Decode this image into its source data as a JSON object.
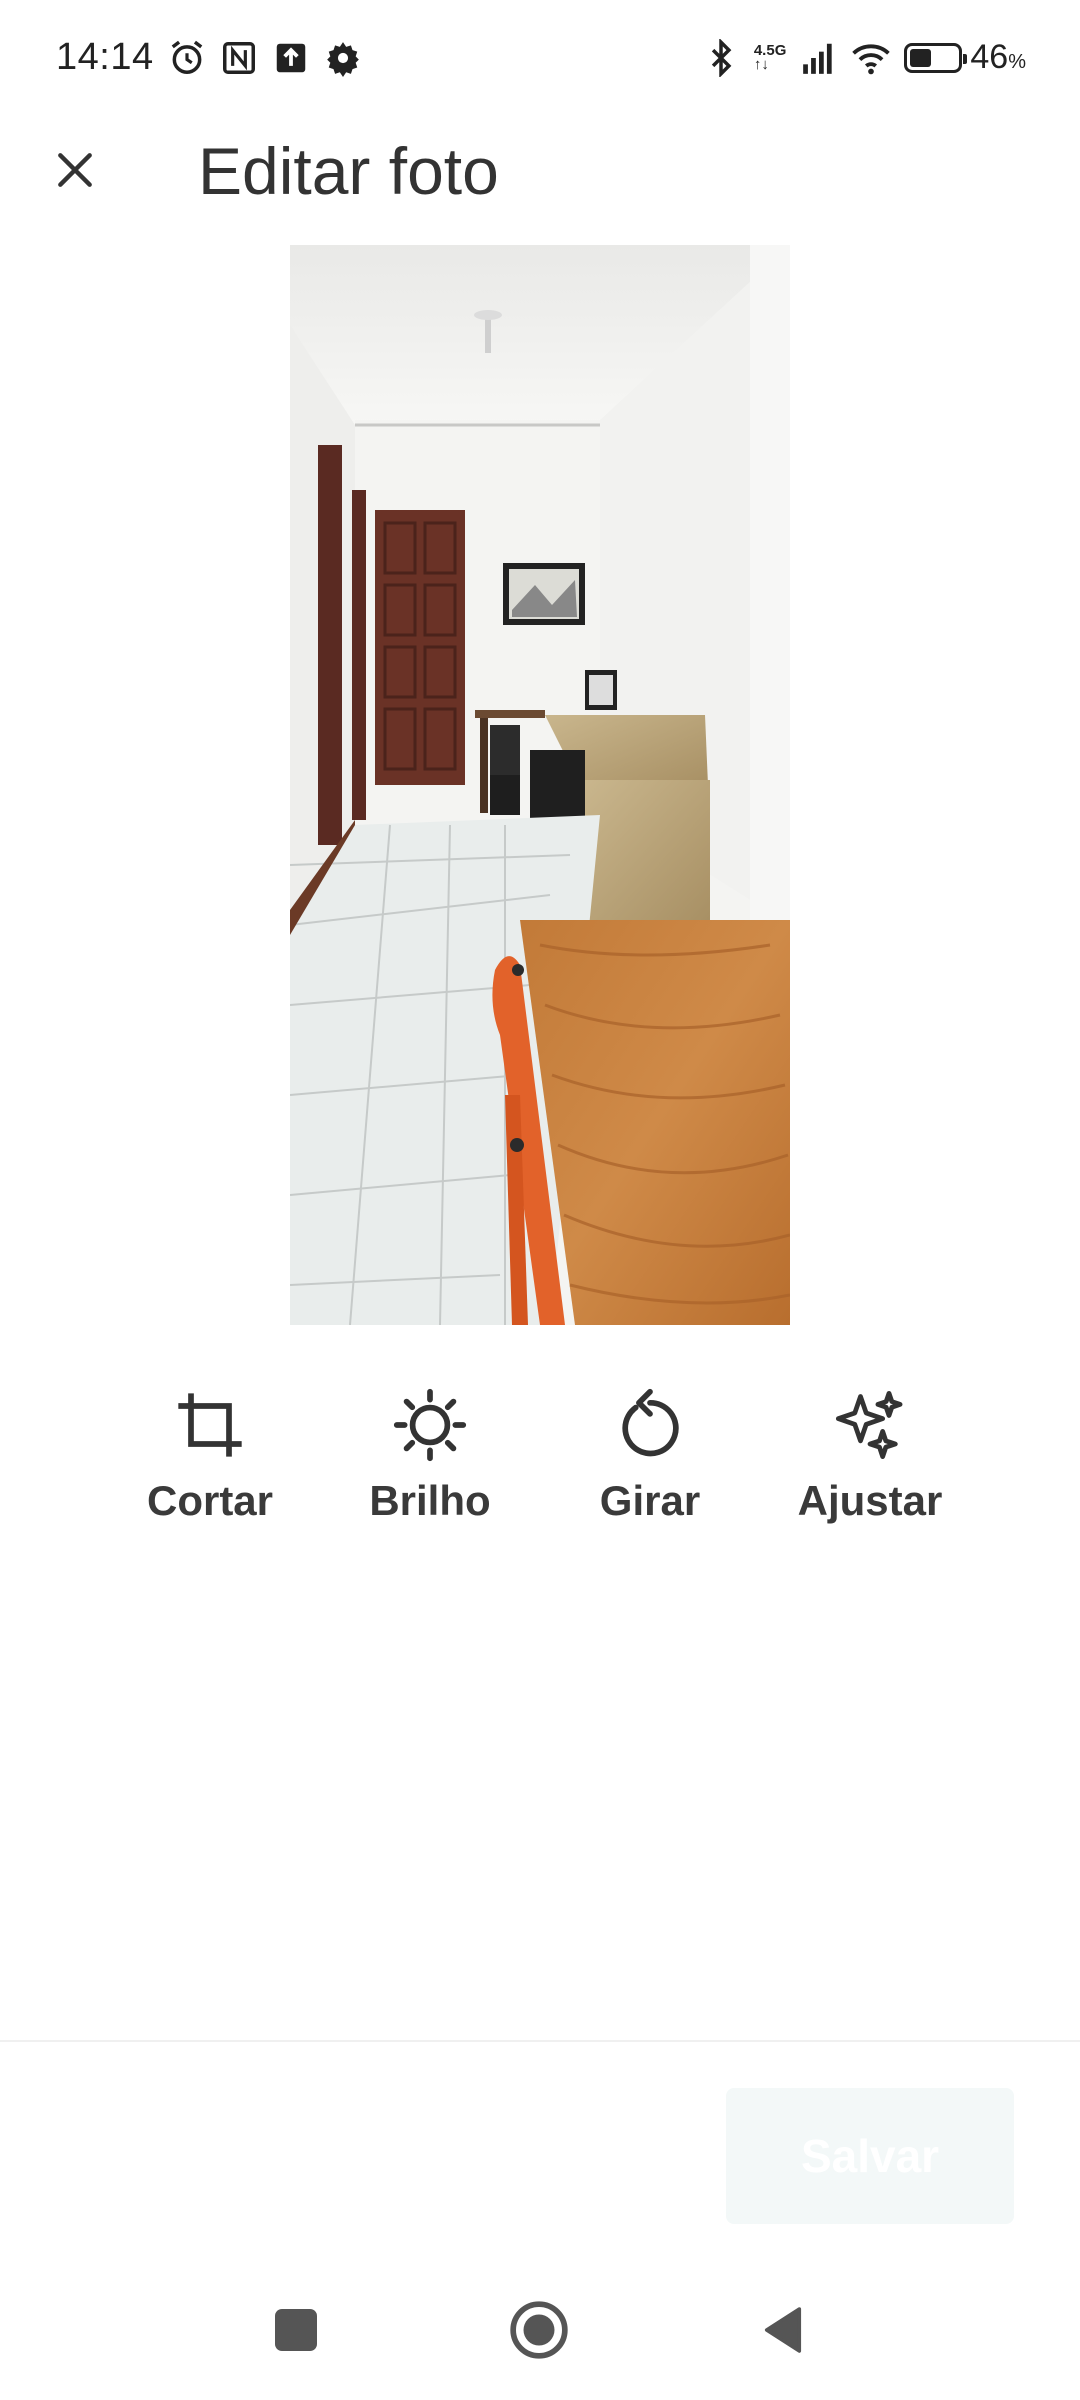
{
  "status_bar": {
    "time": "14:14",
    "network_top": "4.5G",
    "network_bottom": "↑↓",
    "battery_percent": "46",
    "battery_symbol": "%",
    "battery_level": 0.46,
    "icons": [
      "alarm-icon",
      "nfc-icon",
      "upload-icon",
      "settings-icon",
      "bluetooth-icon",
      "signal-icon",
      "wifi-icon",
      "battery-icon"
    ]
  },
  "app_bar": {
    "title": "Editar foto",
    "close_icon": "close-icon"
  },
  "photo": {
    "content": "hallway with wooden table and orange chair"
  },
  "tools": [
    {
      "label": "Cortar",
      "icon": "crop-icon"
    },
    {
      "label": "Brilho",
      "icon": "brightness-icon"
    },
    {
      "label": "Girar",
      "icon": "rotate-icon"
    },
    {
      "label": "Ajustar",
      "icon": "sparkle-icon"
    }
  ],
  "actions": {
    "save_label": "Salvar",
    "save_enabled": false
  },
  "navigation": {
    "icons": [
      "recent-apps-icon",
      "home-icon",
      "back-icon"
    ]
  },
  "colors": {
    "text": "#333333",
    "save_disabled_bg": "#f3f8f8",
    "table_wood": "#c8823f",
    "chair": "#e2622a"
  }
}
